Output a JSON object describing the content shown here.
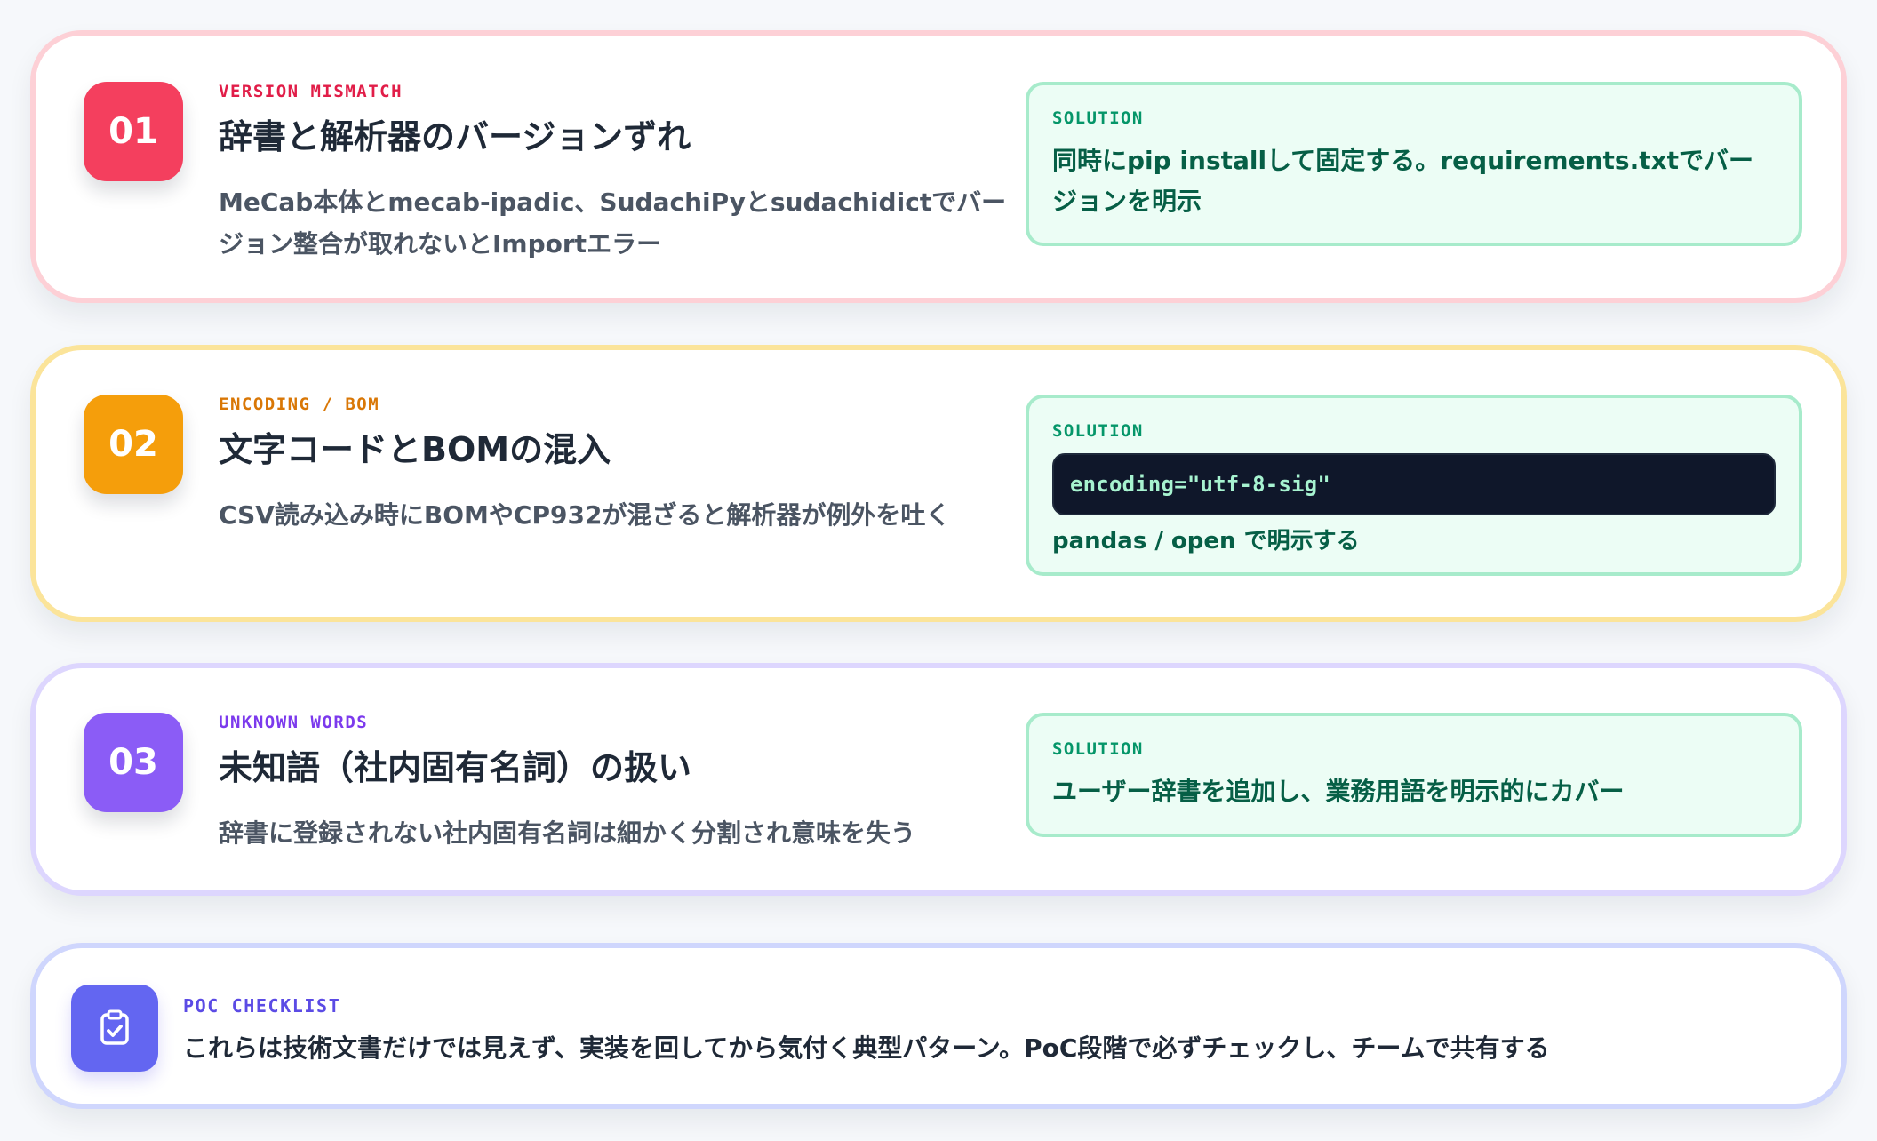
{
  "issues": [
    {
      "number": "01",
      "category": "VERSION MISMATCH",
      "title": "辞書と解析器のバージョンずれ",
      "description": "MeCab本体とmecab-ipadic、SudachiPyとsudachidictでバージョン整合が取れないとImportエラー",
      "solution_label": "SOLUTION",
      "solution_text": "同時にpip installして固定する。requirements.txtでバージョンを明示"
    },
    {
      "number": "02",
      "category": "ENCODING / BOM",
      "title": "文字コードとBOMの混入",
      "description": "CSV読み込み時にBOMやCP932が混ざると解析器が例外を吐く",
      "solution_label": "SOLUTION",
      "solution_code": "encoding=\"utf-8-sig\"",
      "solution_text": "pandas / open で明示する"
    },
    {
      "number": "03",
      "category": "UNKNOWN WORDS",
      "title": "未知語（社内固有名詞）の扱い",
      "description": "辞書に登録されない社内固有名詞は細かく分割され意味を失う",
      "solution_label": "SOLUTION",
      "solution_text": "ユーザー辞書を追加し、業務用語を明示的にカバー"
    }
  ],
  "checklist": {
    "label": "POC CHECKLIST",
    "text": "これらは技術文書だけでは見えず、実装を回してから気付く典型パターン。PoC段階で必ずチェックし、チームで共有する",
    "icon": "clipboard-check-icon"
  }
}
